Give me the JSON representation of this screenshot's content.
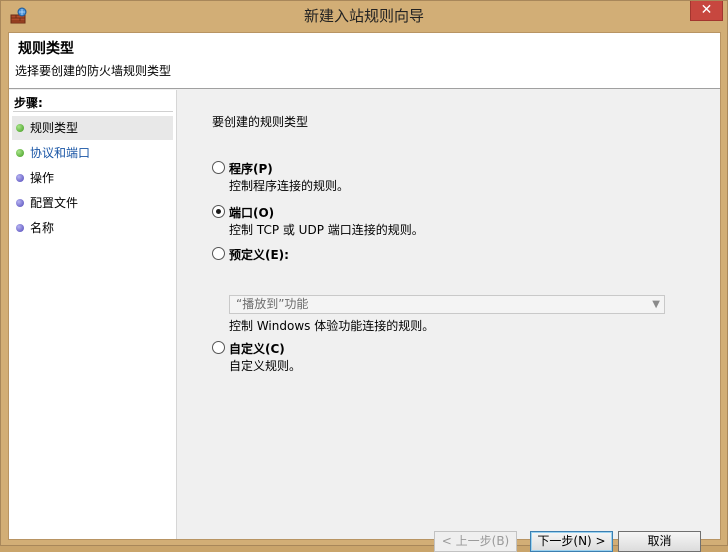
{
  "window": {
    "title": "新建入站规则向导",
    "close_glyph": "✕"
  },
  "header": {
    "title": "规则类型",
    "subtitle": "选择要创建的防火墙规则类型"
  },
  "steps": {
    "heading": "步骤:",
    "items": [
      {
        "label": "规则类型",
        "status": "current"
      },
      {
        "label": "协议和端口",
        "status": "link"
      },
      {
        "label": "操作",
        "status": "pending"
      },
      {
        "label": "配置文件",
        "status": "pending"
      },
      {
        "label": "名称",
        "status": "pending"
      }
    ]
  },
  "main": {
    "prompt": "要创建的规则类型",
    "options": [
      {
        "label": "程序(P)",
        "desc": "控制程序连接的规则。",
        "selected": false
      },
      {
        "label": "端口(O)",
        "desc": "控制 TCP 或 UDP 端口连接的规则。",
        "selected": true
      },
      {
        "label": "预定义(E):",
        "selected": false
      },
      {
        "label": "自定义(C)",
        "desc": "自定义规则。",
        "selected": false
      }
    ],
    "predefined_select_value": "“播放到”功能",
    "predefined_desc": "控制 Windows 体验功能连接的规则。"
  },
  "buttons": {
    "back": "< 上一步(B)",
    "next": "下一步(N) >",
    "cancel": "取消"
  },
  "colors": {
    "frame": "#d2ae76",
    "link": "#1a56a6",
    "close": "#c7473f"
  }
}
